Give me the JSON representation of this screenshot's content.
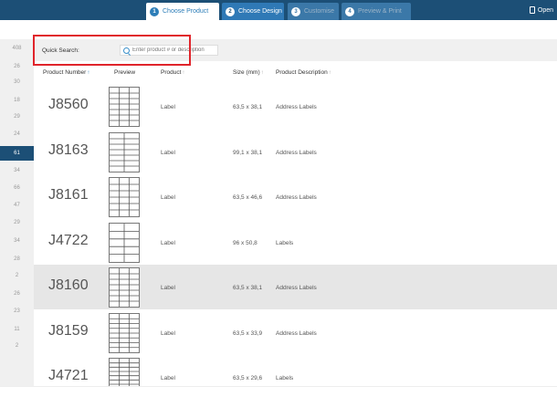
{
  "wizard": {
    "steps": [
      {
        "num": "1",
        "label": "Choose Product"
      },
      {
        "num": "2",
        "label": "Choose Design"
      },
      {
        "num": "3",
        "label": "Customise"
      },
      {
        "num": "4",
        "label": "Preview & Print"
      }
    ],
    "open_label": "Open"
  },
  "sidebar": {
    "counts": [
      "408",
      "26",
      "30",
      "18",
      "29",
      "24",
      "61",
      "34",
      "66",
      "47",
      "29",
      "34",
      "28",
      "2",
      "26",
      "23",
      "11",
      "2"
    ]
  },
  "search": {
    "label": "Quick Search:",
    "placeholder": "Enter product # or description"
  },
  "table": {
    "headers": {
      "product_number": "Product Number",
      "preview": "Preview",
      "product": "Product",
      "size": "Size (mm)",
      "description": "Product Description"
    },
    "rows": [
      {
        "number": "J8560",
        "product": "Label",
        "size": "63,5 x 38,1",
        "description": "Address Labels"
      },
      {
        "number": "J8163",
        "product": "Label",
        "size": "99,1 x 38,1",
        "description": "Address Labels"
      },
      {
        "number": "J8161",
        "product": "Label",
        "size": "63,5 x 46,6",
        "description": "Address Labels"
      },
      {
        "number": "J4722",
        "product": "Label",
        "size": "96 x 50,8",
        "description": "Labels"
      },
      {
        "number": "J8160",
        "product": "Label",
        "size": "63,5 x 38,1",
        "description": "Address Labels"
      },
      {
        "number": "J8159",
        "product": "Label",
        "size": "63,5 x 33,9",
        "description": "Address Labels"
      },
      {
        "number": "J4721",
        "product": "Label",
        "size": "63,5 x 29,6",
        "description": "Labels"
      }
    ]
  },
  "colors": {
    "topbar": "#1c4f76",
    "accent": "#2c7db8",
    "highlight_border": "#e0242b"
  }
}
